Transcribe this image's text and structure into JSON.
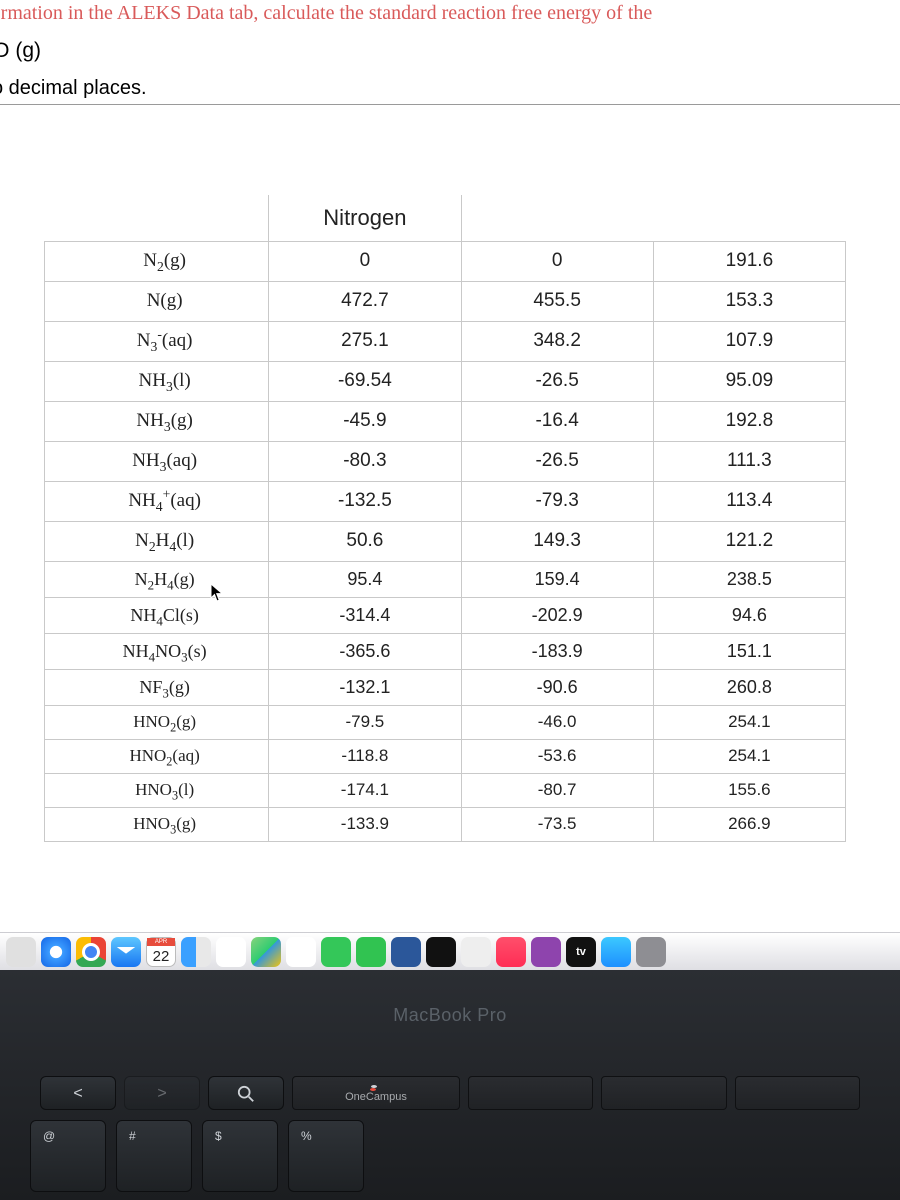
{
  "question": {
    "line1": "nformation in the ALEKS Data tab, calculate the standard reaction free energy of the",
    "line2_html": "NO (g)",
    "line3": "o decimal places."
  },
  "table": {
    "section": "Nitrogen",
    "rows": [
      {
        "formula_html": "N<sub>2</sub>(g)",
        "c2": "0",
        "c3": "0",
        "c4": "191.6"
      },
      {
        "formula_html": "N(g)",
        "c2": "472.7",
        "c3": "455.5",
        "c4": "153.3"
      },
      {
        "formula_html": "N<sub>3</sub><sup>-</sup>(aq)",
        "c2": "275.1",
        "c3": "348.2",
        "c4": "107.9"
      },
      {
        "formula_html": "NH<sub>3</sub>(l)",
        "c2": "-69.54",
        "c3": "-26.5",
        "c4": "95.09"
      },
      {
        "formula_html": "NH<sub>3</sub>(g)",
        "c2": "-45.9",
        "c3": "-16.4",
        "c4": "192.8"
      },
      {
        "formula_html": "NH<sub>3</sub>(aq)",
        "c2": "-80.3",
        "c3": "-26.5",
        "c4": "111.3"
      },
      {
        "formula_html": "NH<sub>4</sub><sup>+</sup>(aq)",
        "c2": "-132.5",
        "c3": "-79.3",
        "c4": "113.4"
      },
      {
        "formula_html": "N<sub>2</sub>H<sub>4</sub>(l)",
        "c2": "50.6",
        "c3": "149.3",
        "c4": "121.2"
      },
      {
        "formula_html": "N<sub>2</sub>H<sub>4</sub>(g)",
        "c2": "95.4",
        "c3": "159.4",
        "c4": "238.5"
      },
      {
        "formula_html": "NH<sub>4</sub>Cl(s)",
        "c2": "-314.4",
        "c3": "-202.9",
        "c4": "94.6"
      },
      {
        "formula_html": "NH<sub>4</sub>NO<sub>3</sub>(s)",
        "c2": "-365.6",
        "c3": "-183.9",
        "c4": "151.1"
      },
      {
        "formula_html": "NF<sub>3</sub>(g)",
        "c2": "-132.1",
        "c3": "-90.6",
        "c4": "260.8"
      },
      {
        "formula_html": "HNO<sub>2</sub>(g)",
        "c2": "-79.5",
        "c3": "-46.0",
        "c4": "254.1"
      },
      {
        "formula_html": "HNO<sub>2</sub>(aq)",
        "c2": "-118.8",
        "c3": "-53.6",
        "c4": "254.1"
      },
      {
        "formula_html": "HNO<sub>3</sub>(l)",
        "c2": "-174.1",
        "c3": "-80.7",
        "c4": "155.6"
      },
      {
        "formula_html": "HNO<sub>3</sub>(g)",
        "c2": "-133.9",
        "c3": "-73.5",
        "c4": "266.9"
      }
    ]
  },
  "dock": {
    "calendar": {
      "month": "APR",
      "day": "22"
    },
    "tv_label": "tv"
  },
  "device": {
    "brand": "MacBook Pro",
    "touchbar_label": "OneCampus",
    "keys": [
      {
        "top": "<",
        "bottom": ""
      },
      {
        "top": ">",
        "bottom": ""
      },
      {
        "top": "",
        "bottom": "Q",
        "icon": "search"
      },
      {
        "top": "@",
        "bottom": ""
      },
      {
        "top": "#",
        "bottom": ""
      },
      {
        "top": "$",
        "bottom": ""
      },
      {
        "top": "%",
        "bottom": ""
      }
    ]
  }
}
